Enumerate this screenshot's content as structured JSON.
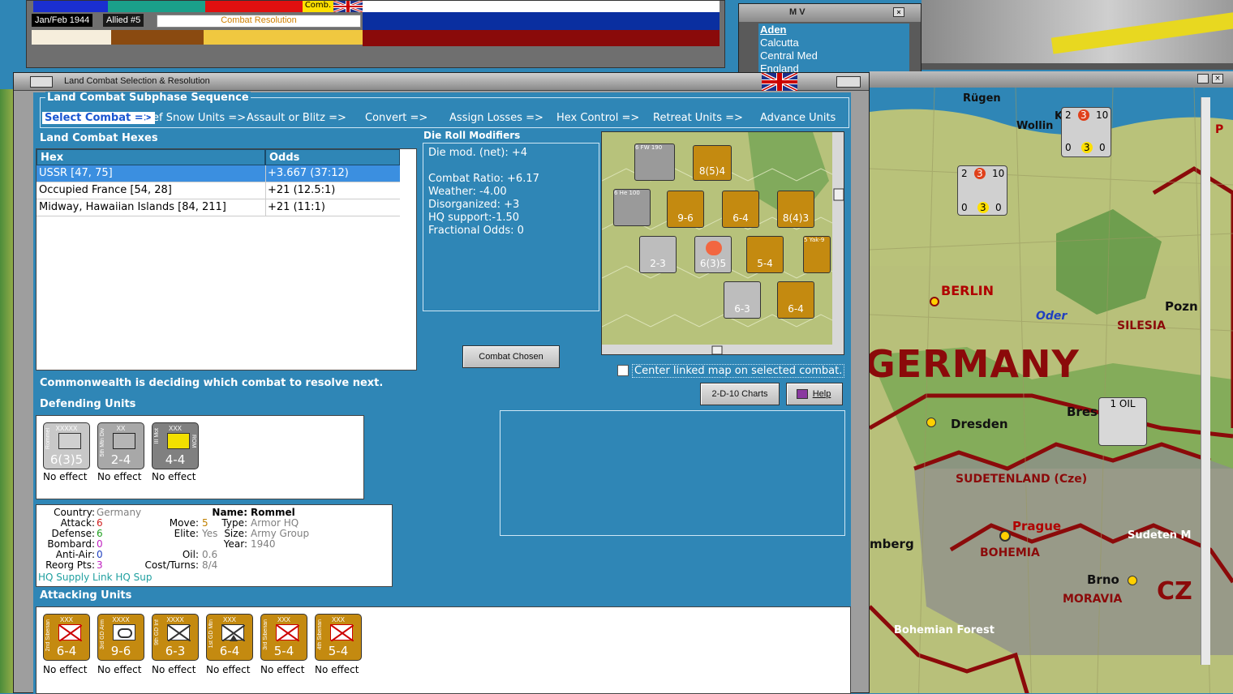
{
  "top_status": {
    "date": "Jan/Feb 1944",
    "side": "Allied #5",
    "phase": "Combat Resolution",
    "comb_label": "Comb."
  },
  "mv_window": {
    "title": "M V",
    "list": [
      "Aden",
      "Calcutta",
      "Central Med",
      "England"
    ]
  },
  "dialog": {
    "title": "Land Combat Selection & Resolution",
    "sequence_title": "Land Combat Subphase Sequence",
    "sequence": [
      "Select Combat =>",
      "Def Snow Units =>",
      "Assault or Blitz =>",
      "Convert =>",
      "Assign Losses =>",
      "Hex Control =>",
      "Retreat Units =>",
      "Advance Units"
    ],
    "hexes_title": "Land Combat Hexes",
    "hex_columns": [
      "Hex",
      "Odds"
    ],
    "hexes": [
      {
        "hex": "USSR [47, 75]",
        "odds": "+3.667 (37:12)"
      },
      {
        "hex": "Occupied France [54, 28]",
        "odds": "+21 (12.5:1)"
      },
      {
        "hex": "Midway, Hawaiian Islands [84, 211]",
        "odds": "+21 (11:1)"
      }
    ],
    "die_title": "Die Roll Modifiers",
    "die_lines": [
      "Die mod. (net): +4",
      "",
      "Combat Ratio: +6.17",
      "Weather: -4.00",
      "Disorganized: +3",
      "HQ support:-1.50",
      "Fractional Odds: 0"
    ],
    "combat_chosen_button": "Combat Chosen",
    "center_checkbox_label": "Center linked map on selected combat.",
    "charts_button": "2-D-10 Charts",
    "help_button": "Help",
    "status_message": "Commonwealth is deciding which combat to resolve next.",
    "defending_title": "Defending Units",
    "defending": [
      {
        "name": "Rommel",
        "size": "XXXXX",
        "strength": "6(3)5",
        "effect": "No effect"
      },
      {
        "name": "5th Mtn Div",
        "size": "XX",
        "strength": "2-4",
        "effect": "No effect"
      },
      {
        "name": "III Mot",
        "size": "XXX",
        "strength": "4-4",
        "effect": "No effect",
        "tag": "ROM"
      }
    ],
    "info": {
      "country_k": "Country:",
      "country_v": "Germany",
      "attack_k": "Attack:",
      "attack_v": "6",
      "defense_k": "Defense:",
      "defense_v": "6",
      "bombard_k": "Bombard:",
      "bombard_v": "0",
      "antiair_k": "Anti-Air:",
      "antiair_v": "0",
      "reorg_k": "Reorg Pts:",
      "reorg_v": "3",
      "move_k": "Move:",
      "move_v": "5",
      "elite_k": "Elite:",
      "elite_v": "Yes",
      "oil_k": "Oil:",
      "oil_v": "0.6",
      "cost_k": "Cost/Turns:",
      "cost_v": "8/4",
      "name_k": "Name:",
      "name_v": "Rommel",
      "type_k": "Type:",
      "type_v": "Armor HQ",
      "size_k": "Size:",
      "size_v": "Army Group",
      "year_k": "Year:",
      "year_v": "1940",
      "supply": "HQ Supply Link HQ Sup"
    },
    "attacking_title": "Attacking Units",
    "attacking": [
      {
        "name": "2nd Siberian",
        "size": "XXX",
        "strength": "6-4",
        "effect": "No effect"
      },
      {
        "name": "3rd GD Arm",
        "size": "XXXX",
        "strength": "9-6",
        "effect": "No effect"
      },
      {
        "name": "9th GD Inf",
        "size": "XXXX",
        "strength": "6-3",
        "effect": "No effect"
      },
      {
        "name": "1st GD Mtn",
        "size": "XXX",
        "strength": "6-4",
        "effect": "No effect"
      },
      {
        "name": "3rd Siberian",
        "size": "XXX",
        "strength": "5-4",
        "effect": "No effect"
      },
      {
        "name": "4th Siberian",
        "size": "XXX",
        "strength": "5-4",
        "effect": "No effect"
      }
    ]
  },
  "minimap_labels": {
    "u1": "6 FW 190",
    "u2": "6 He 100",
    "u3": "8(5)4",
    "u4": "9-6",
    "u5": "6-4",
    "u6": "8(4)3",
    "u7": "2-3",
    "u8": "6(3)5",
    "u9": "5-4",
    "u10": "6-3",
    "u11": "6-4",
    "u12": "5 Yak-9",
    "n1": "3",
    "n2": "4",
    "n3": "2",
    "n4": "3",
    "n5": "3",
    "n6": "4",
    "n7": "3",
    "n8": "6",
    "n9": "4"
  },
  "map": {
    "labels": [
      "Rügen",
      "Wollin",
      "BERLIN",
      "Oder",
      "SILESIA",
      "Pozn",
      "GERMANY",
      "Dresden",
      "Bres",
      "SUDETENLAND (Cze)",
      "Prague",
      "BOHEMIA",
      "Sudeten M",
      "mberg",
      "Brno",
      "MORAVIA",
      "CZ",
      "Bohemian Forest",
      "P"
    ],
    "stack1": [
      "2",
      "3",
      "10",
      "0",
      "3",
      "0"
    ],
    "stack2": [
      "2",
      "3",
      "10",
      "0",
      "3",
      "0"
    ],
    "oil_label": "1 OIL",
    "stack3_k": "K"
  },
  "colors": {
    "sea": "#2f86b6",
    "soviet": "#c48a10",
    "axis": "#8e8e8e",
    "frame": "#9e9e9e"
  }
}
